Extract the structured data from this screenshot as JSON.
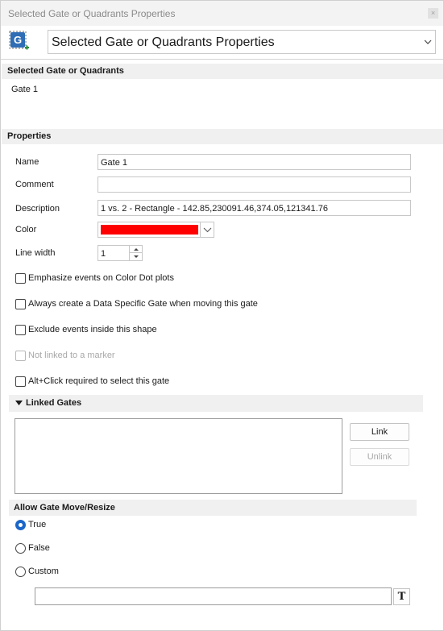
{
  "window": {
    "title": "Selected Gate or Quadrants Properties",
    "close_glyph": "×"
  },
  "header": {
    "icon": "gate-properties-icon",
    "icon_letter": "G",
    "combo_value": "Selected Gate or Quadrants Properties"
  },
  "selected_section": {
    "title": "Selected Gate or Quadrants",
    "item": "Gate 1"
  },
  "properties": {
    "title": "Properties",
    "name_label": "Name",
    "name_value": "Gate 1",
    "comment_label": "Comment",
    "comment_value": "",
    "description_label": "Description",
    "description_value": "1 vs. 2 - Rectangle - 142.85,230091.46,374.05,121341.76",
    "color_label": "Color",
    "color_value": "#ff0000",
    "line_width_label": "Line width",
    "line_width_value": "1"
  },
  "checkboxes": [
    {
      "label": "Emphasize events on Color Dot plots",
      "checked": false,
      "enabled": true
    },
    {
      "label": "Always create a Data Specific Gate when moving this gate",
      "checked": false,
      "enabled": true
    },
    {
      "label": "Exclude events inside this shape",
      "checked": false,
      "enabled": true
    },
    {
      "label": "Not linked to a marker",
      "checked": false,
      "enabled": false
    },
    {
      "label": "Alt+Click required to select this gate",
      "checked": false,
      "enabled": true
    }
  ],
  "linked_gates": {
    "title": "Linked Gates",
    "link_label": "Link",
    "unlink_label": "Unlink"
  },
  "allow_move": {
    "title": "Allow Gate Move/Resize",
    "options": [
      "True",
      "False",
      "Custom"
    ],
    "selected": "True",
    "custom_value": "",
    "text_button_glyph": "T"
  }
}
